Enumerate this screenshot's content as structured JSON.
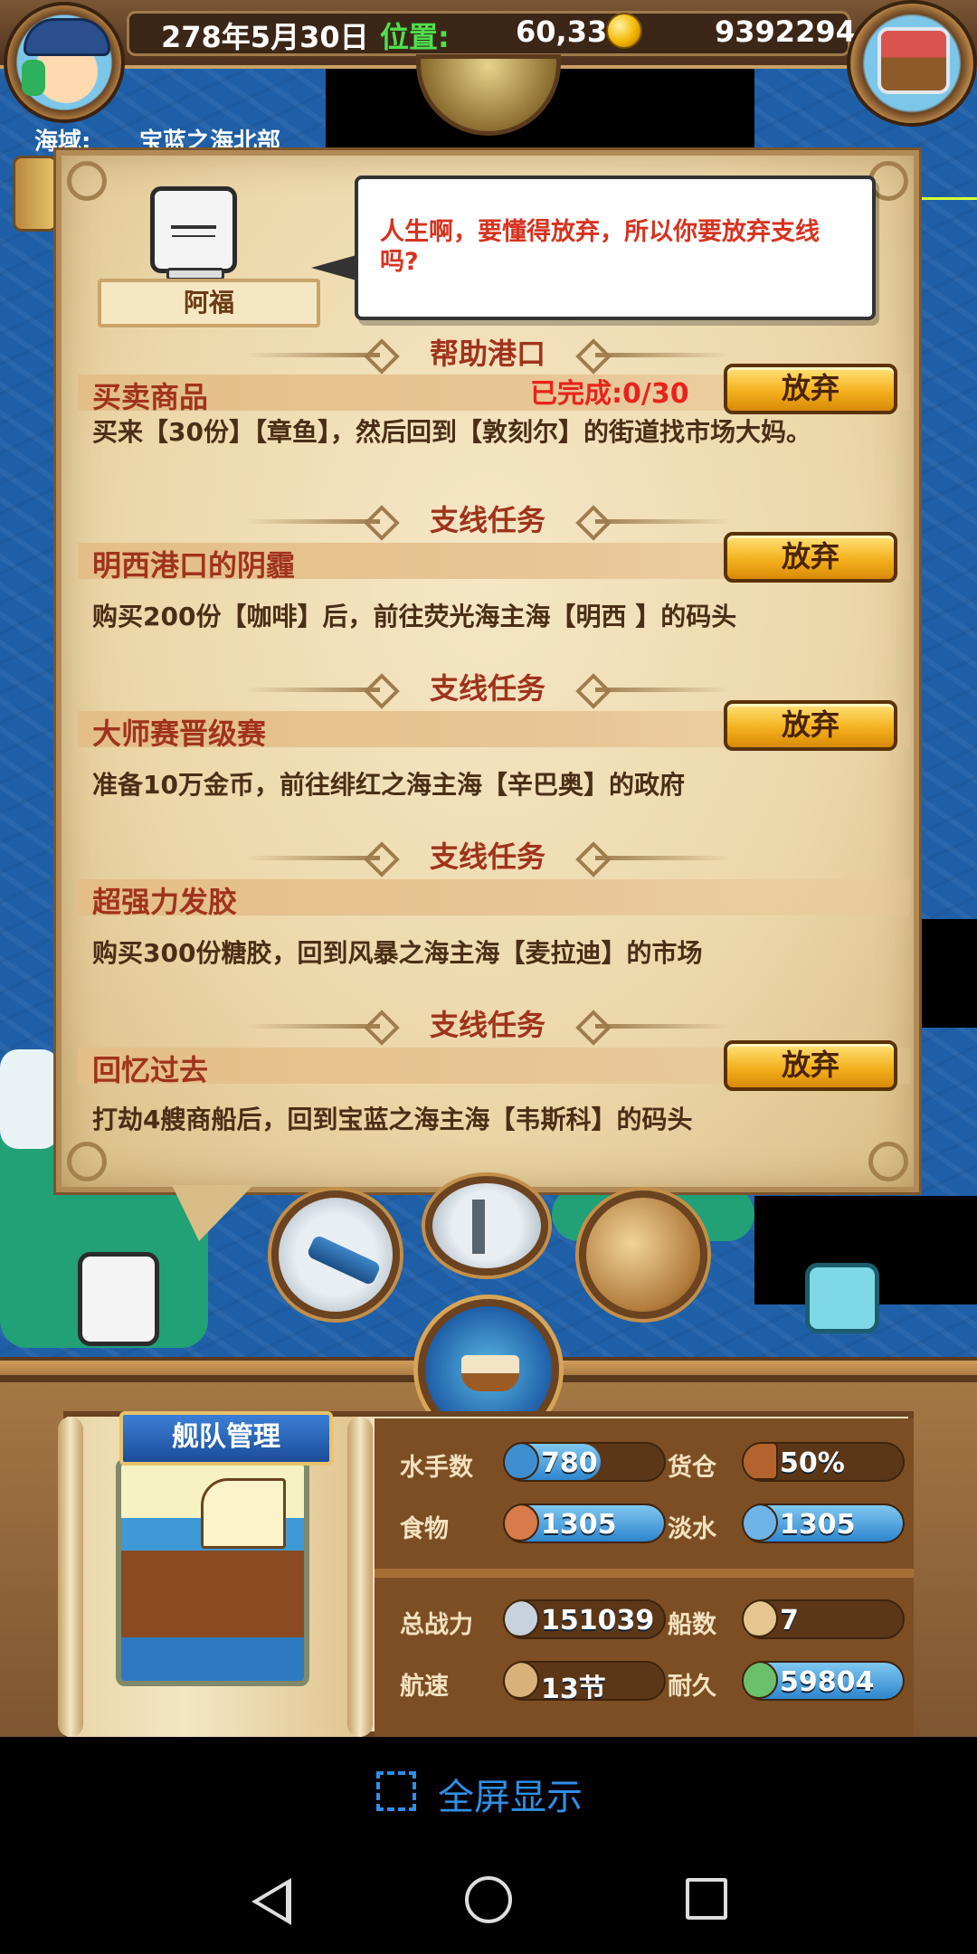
{
  "topbar": {
    "date": "278年5月30日",
    "position_label": "位置:",
    "position_value": "60,33",
    "gold": "9392294",
    "region_label": "海域:",
    "region_value": "宝蓝之海北部"
  },
  "npc": {
    "name": "阿福",
    "speech": "人生啊，要懂得放弃，所以你要放弃支线吗?"
  },
  "quests": [
    {
      "section": "帮助港口",
      "title": "买卖商品",
      "progress": "已完成:0/30",
      "description": "买来【30份】【章鱼】，然后回到【敦刻尔】的街道找市场大妈。",
      "button": "放弃"
    },
    {
      "section": "支线任务",
      "title": "明西港口的阴霾",
      "progress": "",
      "description": "购买200份【咖啡】后，前往荧光海主海【明西 】的码头",
      "button": "放弃"
    },
    {
      "section": "支线任务",
      "title": "大师赛晋级赛",
      "progress": "",
      "description": "准备10万金币，前往绯红之海主海【辛巴奥】的政府",
      "button": "放弃"
    },
    {
      "section": "支线任务",
      "title": "超强力发胶",
      "progress": "",
      "description": "购买300份糖胶，回到风暴之海主海【麦拉迪】的市场",
      "button": ""
    },
    {
      "section": "支线任务",
      "title": "回忆过去",
      "progress": "",
      "description": "打劫4艘商船后，回到宝蓝之海主海【韦斯科】的码头",
      "button": "放弃"
    }
  ],
  "fleet": {
    "title": "舰队管理",
    "stats": {
      "sailors": {
        "label": "水手数",
        "value": "780",
        "fill": 0.6,
        "color": "#2e86cf"
      },
      "cargo": {
        "label": "货仓",
        "value": "50%",
        "fill": 0.08,
        "color": "#2e86cf"
      },
      "food": {
        "label": "食物",
        "value": "1305",
        "fill": 1.0,
        "color": "#2e86cf"
      },
      "water": {
        "label": "淡水",
        "value": "1305",
        "fill": 1.0,
        "color": "#2e86cf"
      },
      "power": {
        "label": "总战力",
        "value": "151039",
        "fill": 0.0,
        "color": "#5b3718"
      },
      "ships": {
        "label": "船数",
        "value": "7",
        "fill": 0.0,
        "color": "#5b3718"
      },
      "speed": {
        "label": "航速",
        "value": "13节",
        "fill": 0.0,
        "color": "#5b3718"
      },
      "durability": {
        "label": "耐久",
        "value": "59804",
        "fill": 1.0,
        "color": "#2e86cf"
      }
    }
  },
  "system": {
    "fullscreen_label": "全屏显示"
  },
  "colors": {
    "accent_red": "#a0331d",
    "progress_red": "#e8231e",
    "button_gold": "#f4b11e",
    "sea_blue": "#1f5fa8"
  }
}
